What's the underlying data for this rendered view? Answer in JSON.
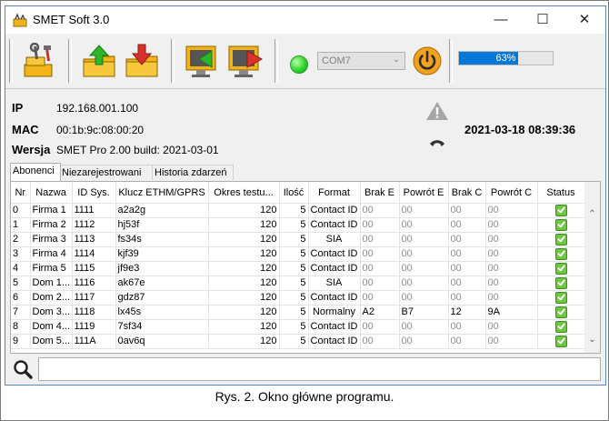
{
  "window": {
    "title": "SMET Soft 3.0"
  },
  "toolbar": {
    "port": "COM7",
    "progress_percent": 63,
    "progress_text": "63%"
  },
  "device": {
    "ip_label": "IP",
    "ip": "192.168.001.100",
    "mac_label": "MAC",
    "mac": "00:1b:9c:08:00:20",
    "version_label": "Wersja",
    "version": "SMET Pro 2.00 build: 2021-03-01",
    "datetime": "2021-03-18 08:39:36"
  },
  "tabs": [
    "Abonenci",
    "Niezarejestrowani",
    "Historia zdarzeń"
  ],
  "table": {
    "columns": [
      "Nr",
      "Nazwa",
      "ID Sys.",
      "Klucz ETHM/GPRS",
      "Okres testu...",
      "Ilość",
      "Format",
      "Brak E",
      "Powrót E",
      "Brak C",
      "Powrót C",
      "Status"
    ],
    "rows": [
      [
        "0",
        "Firma 1",
        "1111",
        "a2a2g",
        "120",
        "5",
        "Contact ID",
        "00",
        "00",
        "00",
        "00"
      ],
      [
        "1",
        "Firma 2",
        "1112",
        "hj53f",
        "120",
        "5",
        "Contact ID",
        "00",
        "00",
        "00",
        "00"
      ],
      [
        "2",
        "Firma 3",
        "1113",
        "fs34s",
        "120",
        "5",
        "SIA",
        "00",
        "00",
        "00",
        "00"
      ],
      [
        "3",
        "Firma 4",
        "1114",
        "kjf39",
        "120",
        "5",
        "Contact ID",
        "00",
        "00",
        "00",
        "00"
      ],
      [
        "4",
        "Firma 5",
        "1115",
        "jf9e3",
        "120",
        "5",
        "Contact ID",
        "00",
        "00",
        "00",
        "00"
      ],
      [
        "5",
        "Dom 1...",
        "1116",
        "ak67e",
        "120",
        "5",
        "SIA",
        "00",
        "00",
        "00",
        "00"
      ],
      [
        "6",
        "Dom 2...",
        "1117",
        "gdz87",
        "120",
        "5",
        "Contact ID",
        "00",
        "00",
        "00",
        "00"
      ],
      [
        "7",
        "Dom 3...",
        "1118",
        "lx45s",
        "120",
        "5",
        "Normalny",
        "A2",
        "B7",
        "12",
        "9A"
      ],
      [
        "8",
        "Dom 4...",
        "1119",
        "7sf34",
        "120",
        "5",
        "Contact ID",
        "00",
        "00",
        "00",
        "00"
      ],
      [
        "9",
        "Dom 5...",
        "111A",
        "0av6q",
        "120",
        "5",
        "Contact ID",
        "00",
        "00",
        "00",
        "00"
      ]
    ]
  },
  "caption": "Rys. 2. Okno główne programu.",
  "colors": {
    "accent": "#0078d7",
    "led": "#2fd62a",
    "power": "#f2a31b",
    "status_ok": "#6cc53f"
  },
  "icons": {
    "tool": "settings-tools-icon",
    "upload": "upload-folder-icon",
    "download": "download-folder-icon",
    "import": "import-device-icon",
    "export": "export-device-icon",
    "power": "power-icon",
    "warning": "warning-icon",
    "phone": "phone-icon",
    "search": "search-icon"
  }
}
